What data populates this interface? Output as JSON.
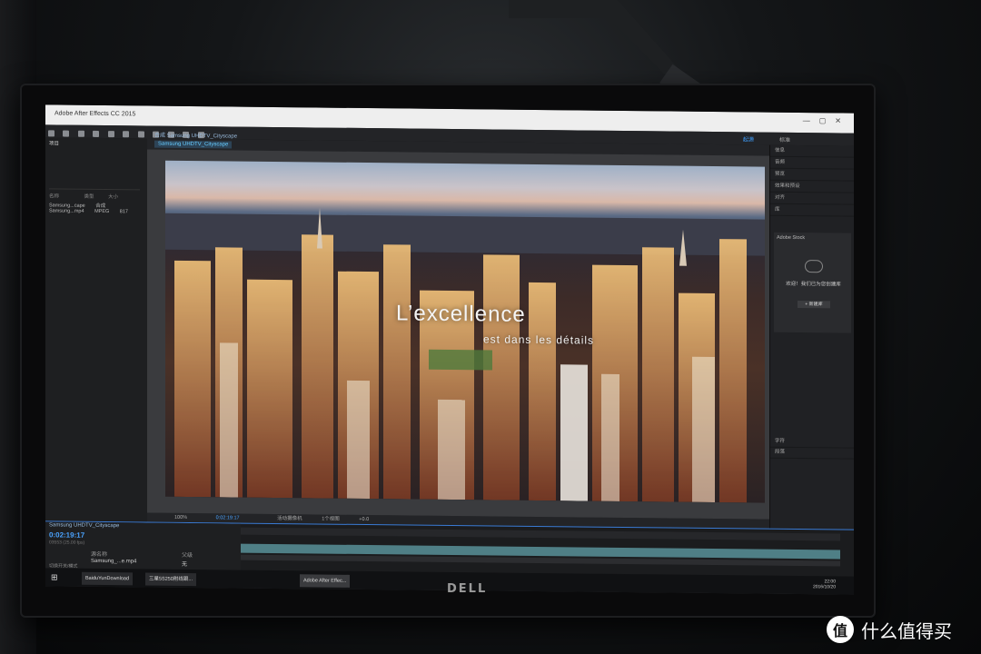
{
  "photo_description_scene": "monitor",
  "window": {
    "title": "Adobe After Effects CC 2015"
  },
  "toolbar": {
    "workspace_label": "标准",
    "workspace_active": "起源"
  },
  "project_panel": {
    "title": "项目",
    "columns": {
      "name": "名称",
      "type": "类型",
      "size": "大小"
    },
    "items": [
      {
        "name": "Samsung...cape",
        "type": "合成",
        "size": ""
      },
      {
        "name": "Samsung...mp4",
        "type": "MPEG",
        "size": "817"
      }
    ]
  },
  "composition": {
    "header": "合成 Samsung UHDTV_Cityscape",
    "tab": "Samsung UHDTV_Cityscape"
  },
  "viewer": {
    "overlay_title": "L’excellence",
    "overlay_subtitle": "est dans les détails",
    "zoom": "100%",
    "timecode": "0:02:19:17",
    "camera": "活动摄像机",
    "views": "1个视图",
    "exposure": "+0.0"
  },
  "right_panel": {
    "items": [
      "信息",
      "音频",
      "预览",
      "效果和预设",
      "对齐"
    ],
    "cc_label": "库",
    "cc_library": "Adobe Stock",
    "cc_message": "欢迎！我们已为您创建库",
    "cc_button": "+ 新建库",
    "lower_items": [
      "字符",
      "段落"
    ]
  },
  "timeline": {
    "comp_name": "Samsung UHDTV_Cityscape",
    "timecode": "0:02:19:17",
    "frames": "03553 (25.00 fps)",
    "layer": "Samsung_...e.mp4",
    "source_col": "源名称",
    "parent_col": "父级",
    "mode_col": "切换开关/模式",
    "parent_value": "无"
  },
  "taskbar": {
    "tasks": [
      "BaiduYunDownload",
      "三星5S250附线跟...",
      "Adobe After Effec..."
    ],
    "time": "22:00",
    "date": "2016/10/20"
  },
  "brand": {
    "monitor": "DELL"
  },
  "watermark": {
    "logo_glyph": "值",
    "text": "什么值得买"
  },
  "colors": {
    "accent": "#3a7bd5",
    "bezel": "#0a0a0b",
    "ui_bg": "#1e1f21"
  }
}
